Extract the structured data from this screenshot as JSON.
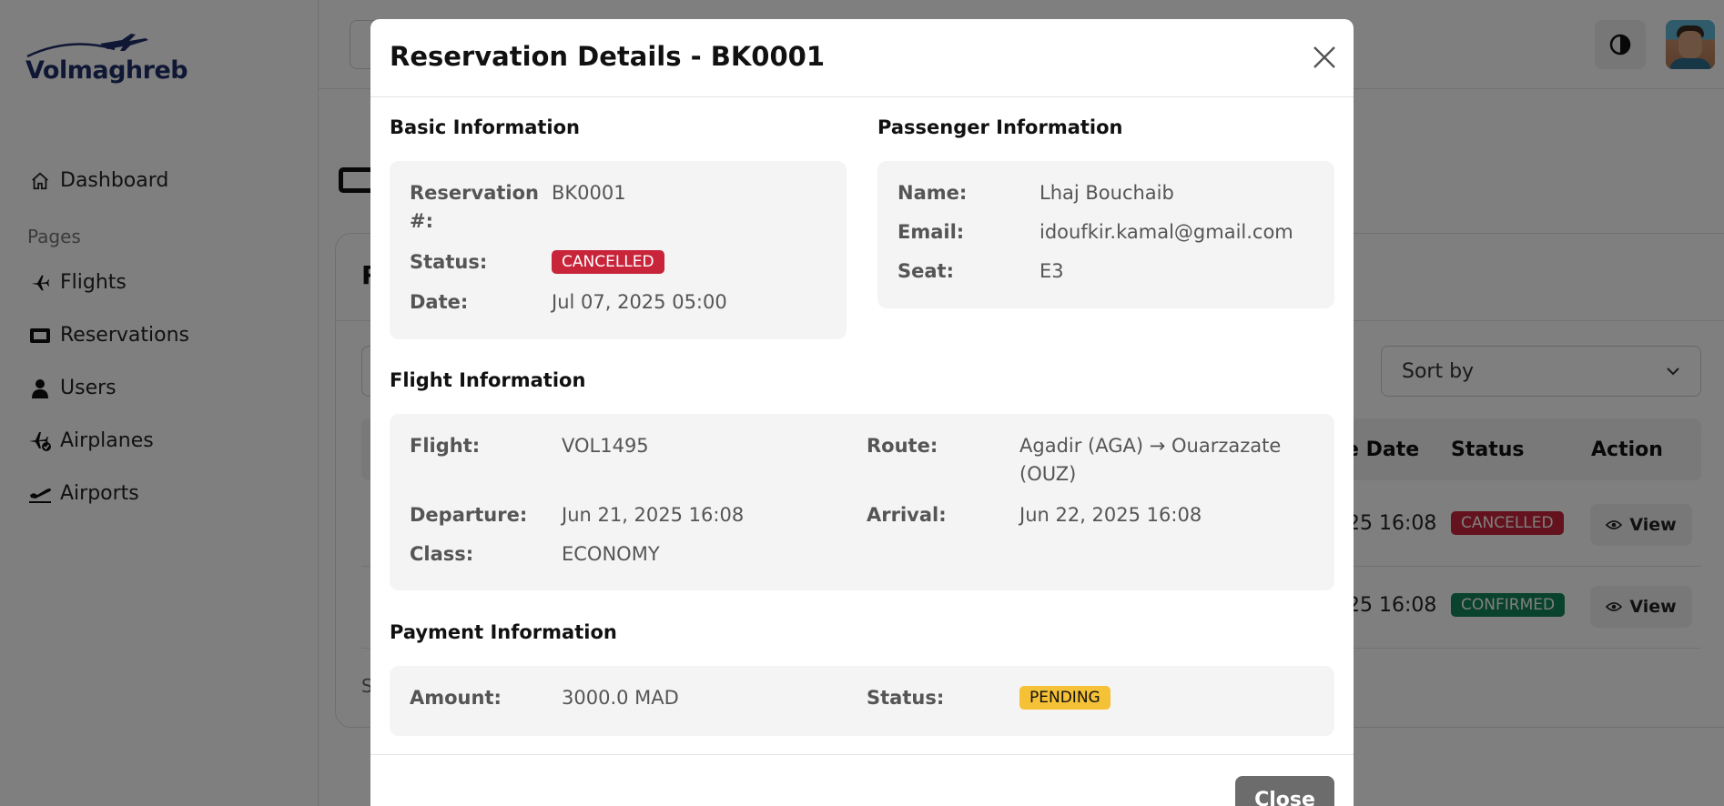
{
  "app": {
    "logo_text": "Volmaghreb"
  },
  "sidebar": {
    "dashboard_label": "Dashboard",
    "section_label": "Pages",
    "items": [
      {
        "label": "Flights",
        "icon": "plane-icon"
      },
      {
        "label": "Reservations",
        "icon": "ticket-icon"
      },
      {
        "label": "Users",
        "icon": "user-icon"
      },
      {
        "label": "Airplanes",
        "icon": "airplane-check-icon"
      },
      {
        "label": "Airports",
        "icon": "plane-departure-icon"
      }
    ]
  },
  "header": {
    "theme_toggle_icon": "half-circle-icon",
    "avatar": "user-avatar"
  },
  "reservations_page": {
    "card_title_initial": "R",
    "sort_label": "Sort by",
    "columns_visible": [
      "e Date",
      "Status",
      "Action"
    ],
    "rows": [
      {
        "date_fragment": "25 16:08",
        "status": "CANCELLED",
        "action": "View"
      },
      {
        "date_fragment": "25 16:08",
        "status": "CONFIRMED",
        "action": "View"
      }
    ],
    "footer_initial": "S"
  },
  "modal": {
    "title": "Reservation Details - BK0001",
    "basic": {
      "heading": "Basic Information",
      "reservation_label": "Reservation #:",
      "reservation_value": "BK0001",
      "status_label": "Status:",
      "status_value": "CANCELLED",
      "date_label": "Date:",
      "date_value": "Jul 07, 2025 05:00"
    },
    "passenger": {
      "heading": "Passenger Information",
      "name_label": "Name:",
      "name_value": "Lhaj Bouchaib",
      "email_label": "Email:",
      "email_value": "idoufkir.kamal@gmail.com",
      "seat_label": "Seat:",
      "seat_value": "E3"
    },
    "flight": {
      "heading": "Flight Information",
      "flight_label": "Flight:",
      "flight_value": "VOL1495",
      "route_label": "Route:",
      "route_value_line1": "Agadir (AGA) → Ouarzazate",
      "route_value_line2": "(OUZ)",
      "departure_label": "Departure:",
      "departure_value": "Jun 21, 2025 16:08",
      "arrival_label": "Arrival:",
      "arrival_value": "Jun 22, 2025 16:08",
      "class_label": "Class:",
      "class_value": "ECONOMY"
    },
    "payment": {
      "heading": "Payment Information",
      "amount_label": "Amount:",
      "amount_value": "3000.0 MAD",
      "status_label": "Status:",
      "status_value": "PENDING"
    },
    "close_label": "Close"
  },
  "colors": {
    "cancelled": "#c8243a",
    "confirmed": "#13845a",
    "pending": "#f5c137",
    "brand": "#1e2f6b"
  }
}
